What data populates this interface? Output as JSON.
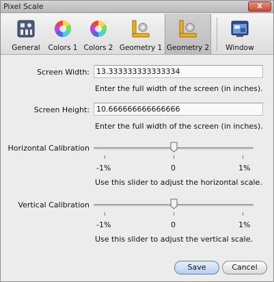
{
  "window": {
    "title": "Pixel Scale",
    "close_symbol": "X"
  },
  "toolbar": {
    "items": [
      {
        "label": "General",
        "icon": "general-switches-icon"
      },
      {
        "label": "Colors 1",
        "icon": "color-wheel-icon"
      },
      {
        "label": "Colors 2",
        "icon": "color-wheel-icon"
      },
      {
        "label": "Geometry 1",
        "icon": "ruler-triangle-icon"
      },
      {
        "label": "Geometry 2",
        "icon": "ruler-triangle-icon",
        "selected": true
      },
      {
        "label": "Window",
        "icon": "window-icon"
      }
    ]
  },
  "form": {
    "screen_width": {
      "label": "Screen Width:",
      "value": "13.333333333333334",
      "hint": "Enter the full width of the screen (in inches)."
    },
    "screen_height": {
      "label": "Screen Height:",
      "value": "10.666666666666666",
      "hint": "Enter the full width of the screen (in inches)."
    },
    "horizontal_calibration": {
      "label": "Horizontal Calibration",
      "min_label": "-1%",
      "mid_label": "0",
      "max_label": "1%",
      "value_percent": 0,
      "hint": "Use this slider to adjust the horizontal scale."
    },
    "vertical_calibration": {
      "label": "Vertical Calibration",
      "min_label": "-1%",
      "mid_label": "0",
      "max_label": "1%",
      "value_percent": 0,
      "hint": "Use this slider to adjust the vertical scale."
    }
  },
  "buttons": {
    "save": "Save",
    "cancel": "Cancel"
  },
  "colors": {
    "accent": "#5a7fb0",
    "selected_tab": "#c6c6c6"
  }
}
